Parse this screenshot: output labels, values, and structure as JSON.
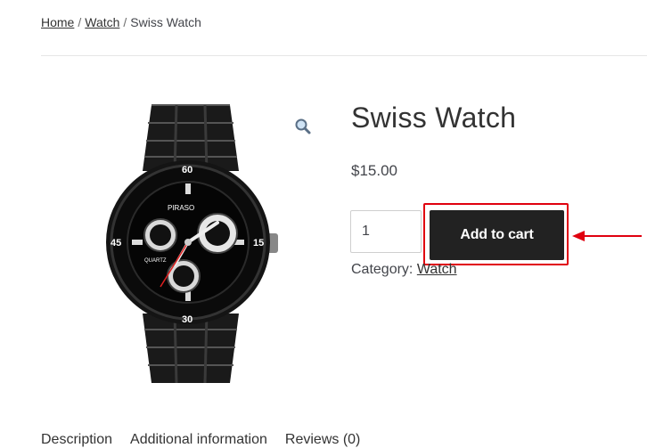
{
  "breadcrumb": {
    "items": [
      "Home",
      "Watch"
    ],
    "separator": "/",
    "current": "Swiss Watch"
  },
  "product": {
    "title": "Swiss Watch",
    "price": "$15.00",
    "quantity": "1",
    "add_to_cart_label": "Add to cart",
    "category_label": "Category:",
    "category_link": "Watch",
    "zoom_icon": "magnifier-icon",
    "image": {
      "brand": "PIRASO",
      "dial_label": "QUARTZ",
      "numerals": [
        "60",
        "15",
        "30",
        "45"
      ]
    }
  },
  "tabs": [
    "Description",
    "Additional information",
    "Reviews (0)"
  ],
  "colors": {
    "button_bg": "#222222",
    "highlight": "#e0000f",
    "text": "#43454b"
  }
}
